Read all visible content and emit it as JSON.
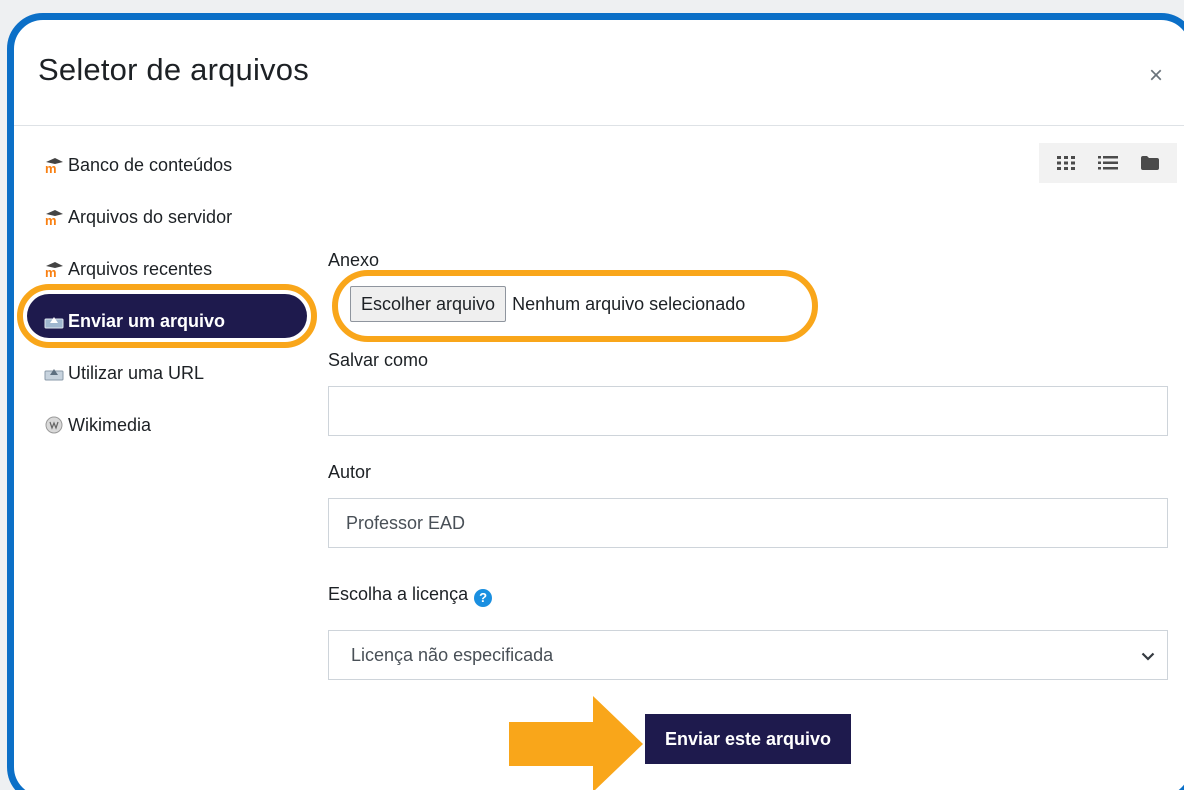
{
  "dialog": {
    "title": "Seletor de arquivos",
    "close_label": "×"
  },
  "sidebar": {
    "items": [
      {
        "label": "Banco de conteúdos",
        "icon": "moodle-icon"
      },
      {
        "label": "Arquivos do servidor",
        "icon": "moodle-icon"
      },
      {
        "label": "Arquivos recentes",
        "icon": "moodle-icon"
      },
      {
        "label": "Enviar um arquivo",
        "icon": "upload-icon",
        "active": true
      },
      {
        "label": "Utilizar uma URL",
        "icon": "url-icon"
      },
      {
        "label": "Wikimedia",
        "icon": "wikimedia-icon"
      }
    ]
  },
  "view_toggles": [
    "grid-view-icon",
    "list-view-icon",
    "folder-view-icon"
  ],
  "form": {
    "attachment_label": "Anexo",
    "choose_file_button": "Escolher arquivo",
    "file_status": "Nenhum arquivo selecionado",
    "save_as_label": "Salvar como",
    "save_as_value": "",
    "author_label": "Autor",
    "author_value": "Professor EAD",
    "license_label": "Escolha a licença",
    "license_selected": "Licença não especificada",
    "submit_button": "Enviar este arquivo"
  },
  "colors": {
    "frame_border": "#0b6fc7",
    "highlight": "#f9a61a",
    "active_bg": "#1e1a4d",
    "moodle_orange": "#f98012"
  }
}
